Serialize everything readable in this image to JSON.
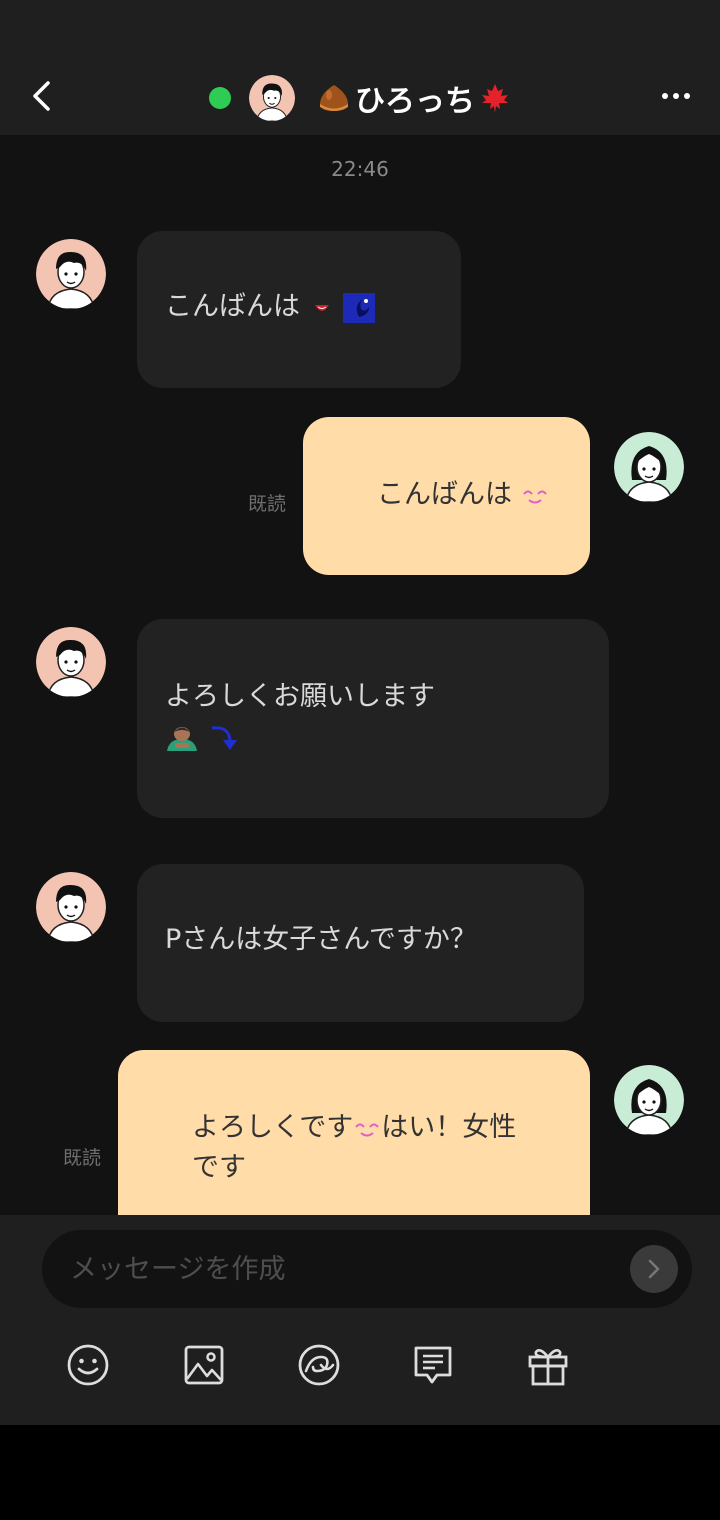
{
  "header": {
    "title": "ひろっち",
    "title_prefix_icon": "chestnut-icon",
    "title_suffix_icon": "maple-leaf-icon",
    "online_color": "#2ecc55"
  },
  "chat": {
    "timestamp": "22:46",
    "messages": [
      {
        "direction": "in",
        "text": "こんばんは",
        "emojis": [
          "devil-smile-emoji",
          "crescent-moon-emoji"
        ]
      },
      {
        "direction": "out",
        "text": "こんばんは",
        "read": "既読",
        "emojis": [
          "smiling-face-emoji"
        ]
      },
      {
        "direction": "in",
        "text": "よろしくお願いします",
        "emojis": [
          "bowing-person-emoji",
          "curved-arrow-emoji"
        ]
      },
      {
        "direction": "in",
        "text": "Pさんは女子さんですか？"
      },
      {
        "direction": "out",
        "text_before": "よろしくです",
        "text_after": "はい！女性",
        "text_line2": "です",
        "read": "既読",
        "emojis": [
          "smiling-face-emoji"
        ]
      }
    ]
  },
  "composer": {
    "placeholder": "メッセージを作成",
    "toolbar": [
      "smile-icon",
      "image-icon",
      "sticker-icon",
      "template-message-icon",
      "gift-icon"
    ]
  },
  "colors": {
    "incoming_bubble": "#222222",
    "outgoing_bubble": "#ffdca8",
    "background": "#121212",
    "bar": "#1f1f1f"
  }
}
